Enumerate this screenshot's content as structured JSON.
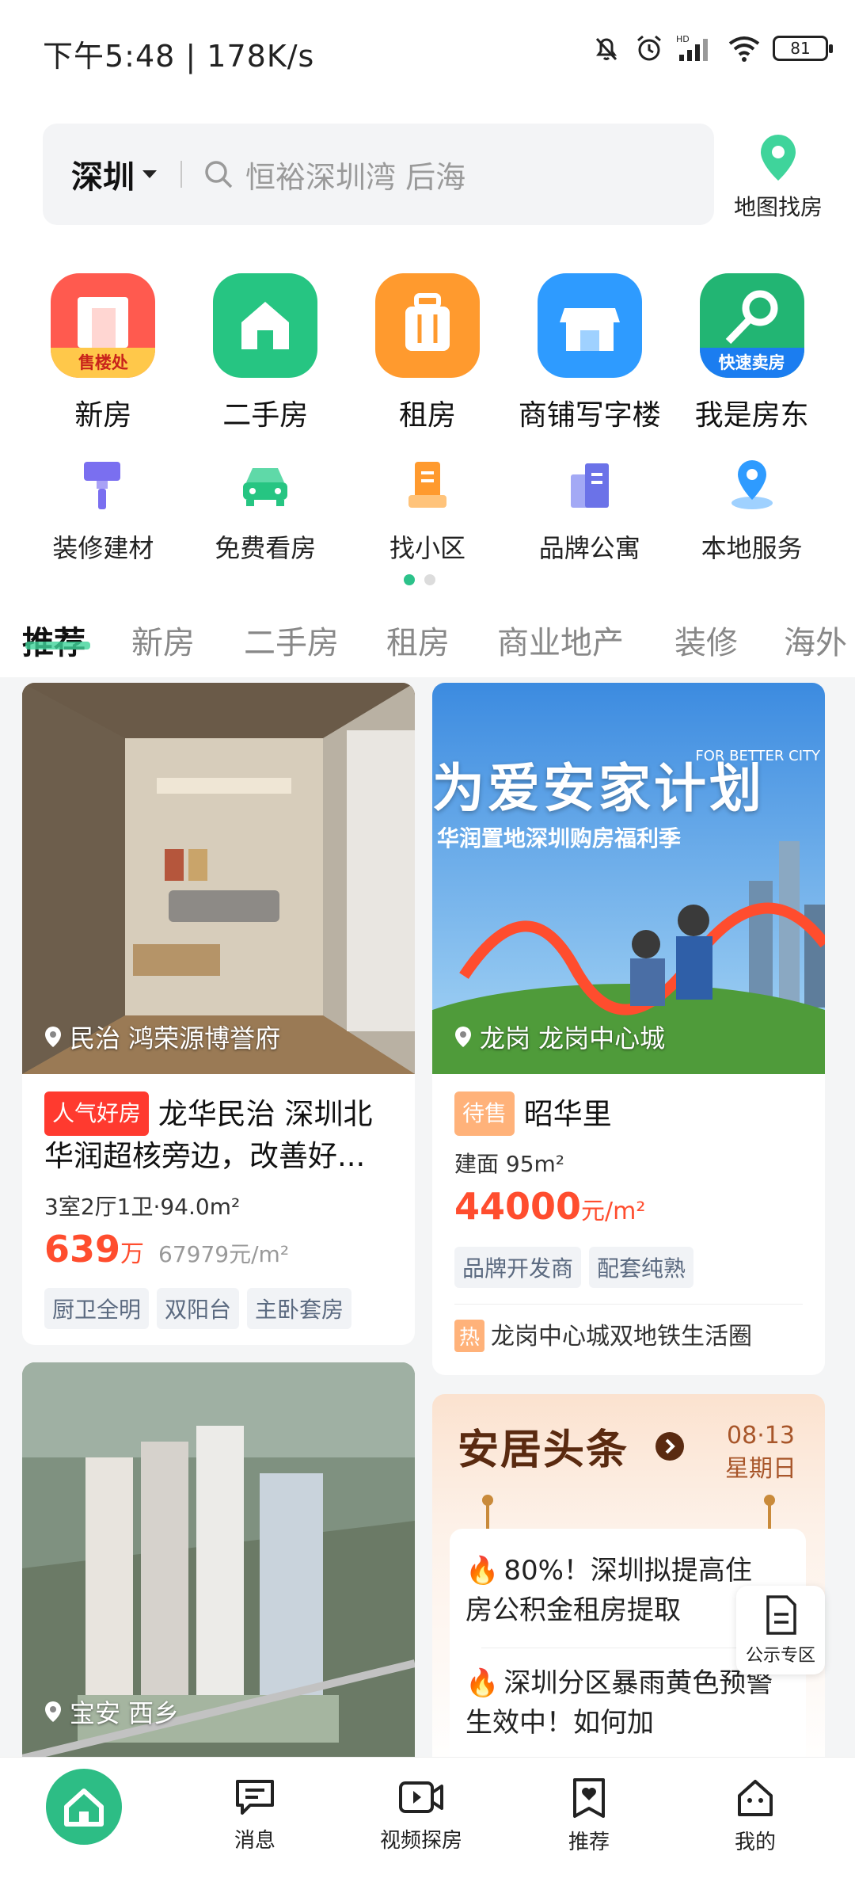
{
  "status_bar": {
    "time": "下午5:48 | 178K/s",
    "battery": "81"
  },
  "search": {
    "city": "深圳",
    "placeholder": "恒裕深圳湾 后海",
    "map_label": "地图找房"
  },
  "primary_categories": [
    {
      "label": "新房",
      "badge": "售楼处",
      "icon": "building-icon",
      "color": "#ff5a4f"
    },
    {
      "label": "二手房",
      "badge": "",
      "icon": "house-icon",
      "color": "#26c582"
    },
    {
      "label": "租房",
      "badge": "",
      "icon": "suitcase-icon",
      "color": "#ff9a2e"
    },
    {
      "label": "商铺写字楼",
      "badge": "",
      "icon": "shop-icon",
      "color": "#2e9bff"
    },
    {
      "label": "我是房东",
      "badge": "快速卖房",
      "icon": "key-icon",
      "color": "#22b573"
    }
  ],
  "secondary_categories": [
    {
      "label": "装修建材",
      "icon": "paint-brush-icon"
    },
    {
      "label": "免费看房",
      "icon": "car-icon"
    },
    {
      "label": "找小区",
      "icon": "community-icon"
    },
    {
      "label": "品牌公寓",
      "icon": "apartment-icon"
    },
    {
      "label": "本地服务",
      "icon": "location-service-icon"
    }
  ],
  "feed_tabs": [
    "推荐",
    "新房",
    "二手房",
    "租房",
    "商业地产",
    "装修",
    "海外"
  ],
  "listing_1": {
    "location": "民治 鸿荣源博誉府",
    "tag": "人气好房",
    "title": "龙华民治 深圳北华润超核旁边，改善好...",
    "layout": "3室2厅1卫·94.0m²",
    "price": "639",
    "price_unit": "万",
    "unit_price": "67979元/m²",
    "chips": [
      "厨卫全明",
      "双阳台",
      "主卧套房"
    ]
  },
  "listing_2": {
    "banner_headline": "为爱安家计划",
    "banner_sub": "华润置地深圳购房福利季",
    "banner_en": "FOR BETTER CITY",
    "location": "龙岗 龙岗中心城",
    "tag": "待售",
    "title": "昭华里",
    "area": "建面 95m²",
    "price": "44000",
    "price_unit": "元/m²",
    "chips": [
      "品牌开发商",
      "配套纯熟"
    ],
    "hot_tag": "热",
    "hot_text": "龙岗中心城双地铁生活圈"
  },
  "listing_3": {
    "location": "宝安 西乡"
  },
  "news": {
    "title": "安居头条",
    "date": "08·13",
    "weekday": "星期日",
    "items": [
      "80%！深圳拟提高住房公积金租房提取",
      "深圳分区暴雨黄色预警生效中！如何加"
    ]
  },
  "floating": {
    "label": "公示专区"
  },
  "bottom_nav": [
    "消息",
    "视频探房",
    "推荐",
    "我的"
  ],
  "colors": {
    "brand_green": "#2dbd85",
    "price_red": "#ff4d2e"
  }
}
